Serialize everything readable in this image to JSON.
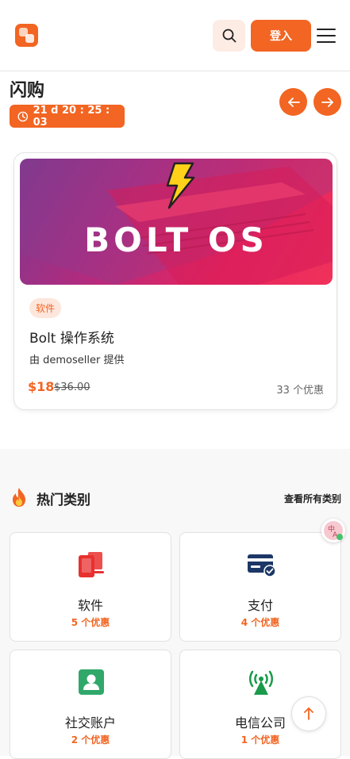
{
  "header": {
    "logo_icon": "app-logo-icon",
    "search_icon": "search-icon",
    "login_label": "登入",
    "menu_icon": "hamburger-menu-icon",
    "accent_color": "#f26522"
  },
  "flash_sale": {
    "title": "闪购",
    "countdown": "21 d 20 : 25 : 03",
    "prev_icon": "arrow-left-icon",
    "next_icon": "arrow-right-icon",
    "deal": {
      "image_text": "BOLT OS",
      "tag": "软件",
      "title": "Bolt 操作系统",
      "seller": "由 demoseller 提供",
      "price": "$18",
      "original_price": "$36.00",
      "deals_count": "33 个优惠"
    }
  },
  "categories": {
    "heading": "热门类别",
    "view_all": "查看所有类别",
    "items": [
      {
        "name": "软件",
        "count": "5 个优惠",
        "icon": "devices-icon"
      },
      {
        "name": "支付",
        "count": "4 个优惠",
        "icon": "credit-card-icon"
      },
      {
        "name": "社交账户",
        "count": "2 个优惠",
        "icon": "contact-card-icon"
      },
      {
        "name": "电信公司",
        "count": "1 个优惠",
        "icon": "signal-tower-icon"
      }
    ]
  }
}
